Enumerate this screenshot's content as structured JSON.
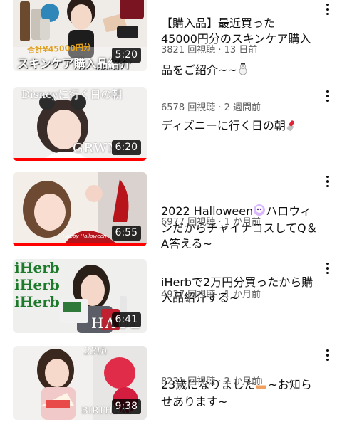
{
  "videos": [
    {
      "title": "【購入品】最近買った\n45000円分のスキンケア購入品をご紹介~~",
      "views": "3821 回視聴",
      "age": "13 日前",
      "duration": "5:20",
      "progress": 0,
      "thumb_text_top": "合計¥45000円分",
      "thumb_text_main": "スキンケア購入品紹介",
      "emoji": "snowman-emoji"
    },
    {
      "title": "ディズニーに行く日の朝",
      "views": "6578 回視聴",
      "age": "2 週間前",
      "duration": "6:20",
      "progress": 1,
      "thumb_text_top": "Disneyに行く日の朝",
      "thumb_text_main": "GRWM",
      "emoji": "lipstick-emoji"
    },
    {
      "title": "2022 Halloween",
      "title_rest": "ハロウィンだからチャイナコスしてQ＆A答える~",
      "views": "6977 回視聴",
      "age": "1 か月前",
      "duration": "6:55",
      "progress": 1,
      "thumb_text_top": "Happy Halloween",
      "emoji": "skull-emoji"
    },
    {
      "title": "iHerbで2万円分買ったから購入品紹介する~",
      "views": "4937 回視聴",
      "age": "1 か月前",
      "duration": "6:41",
      "progress": 0,
      "thumb_text_top": "iHerb",
      "thumb_text_main": "HAUL"
    },
    {
      "title": "23歳になりました",
      "title_rest": "~お知らせあります~",
      "views": "8231 回視聴",
      "age": "2 か月前",
      "duration": "9:38",
      "progress": 0,
      "thumb_text_top": "23th",
      "thumb_text_main": "BIRTHDAY",
      "emoji": "cake-emoji"
    }
  ],
  "separator": " · "
}
